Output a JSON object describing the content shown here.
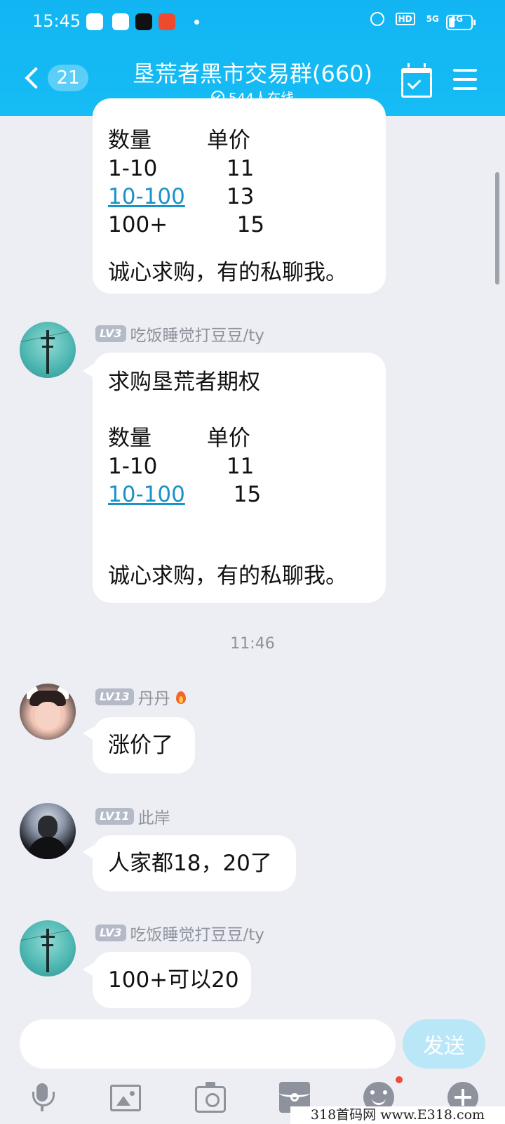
{
  "status_bar": {
    "time": "15:45",
    "network_labels": [
      "HD",
      "5G",
      "4G"
    ]
  },
  "header": {
    "back_count": "21",
    "title": "垦荒者黑市交易群(660)",
    "online_text": "544人在线"
  },
  "messages": [
    {
      "partial": true,
      "lines": [
        "数量        单价",
        "1-10          11",
        "10-100      13",
        "100+          15",
        "",
        "诚心求购，有的私聊我。"
      ],
      "link_text": "10-100"
    },
    {
      "level": "LV3",
      "sender": "吃饭睡觉打豆豆/ty",
      "lines": [
        "求购垦荒者期权",
        "",
        "数量        单价",
        "1-10          11",
        "10-100      15",
        "",
        "",
        "诚心求购，有的私聊我。"
      ],
      "link_text": "10-100"
    },
    {
      "timestamp": "11:46"
    },
    {
      "level": "LV13",
      "sender": "丹丹",
      "text": "涨价了"
    },
    {
      "level": "LV11",
      "sender": "此岸",
      "text": "人家都18，20了"
    },
    {
      "level": "LV3",
      "sender": "吃饭睡觉打豆豆/ty",
      "text": "100+可以20"
    }
  ],
  "input": {
    "placeholder": "",
    "send_label": "发送"
  },
  "toolbar": [
    "mic-icon",
    "image-icon",
    "camera-icon",
    "red-packet-icon",
    "emoji-icon",
    "plus-icon"
  ],
  "watermark": "318首码网  www.E318.com",
  "colors": {
    "header": "#16BCF5",
    "link": "#1A92C7",
    "background": "#ECEEF3",
    "send_button": "#B9E7F8"
  }
}
